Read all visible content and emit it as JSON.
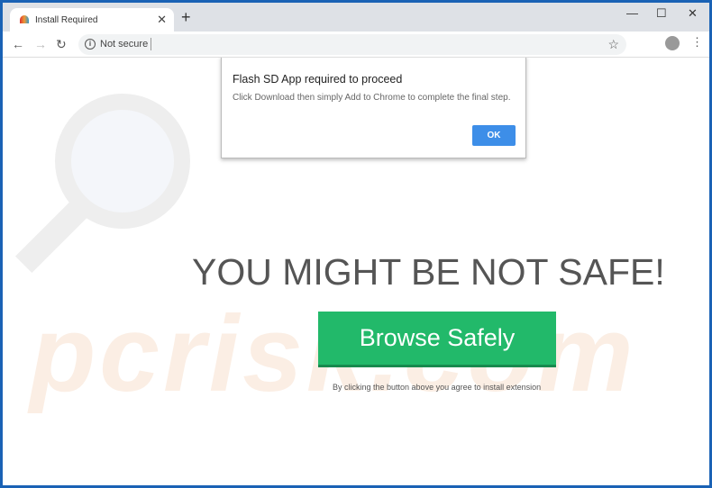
{
  "browser": {
    "tab_title": "Install Required",
    "tab_close": "✕",
    "new_tab": "+",
    "window_controls": {
      "minimize": "—",
      "maximize": "☐",
      "close": "✕"
    },
    "nav": {
      "back": "←",
      "forward": "→",
      "reload": "↻"
    },
    "security_label": "Not secure",
    "info_icon": "i",
    "bookmark_icon": "☆",
    "menu_icon": "⋮"
  },
  "dialog": {
    "title": "Flash SD App required to proceed",
    "message": "Click Download then simply Add to Chrome to complete the final step.",
    "ok_label": "OK"
  },
  "page": {
    "headline": "YOU MIGHT BE NOT SAFE!",
    "cta_label": "Browse Safely",
    "consent_text": "By clicking the button above you agree to install extension",
    "watermark": "pcrisk.com"
  },
  "colors": {
    "cta": "#22b96a",
    "ok": "#3d8ee8",
    "window_border": "#1a62b5"
  }
}
